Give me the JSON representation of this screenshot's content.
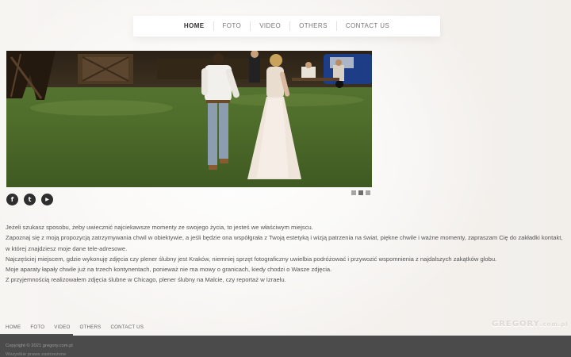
{
  "nav": {
    "items": [
      {
        "label": "HOME",
        "active": true
      },
      {
        "label": "FOTO"
      },
      {
        "label": "VIDEO"
      },
      {
        "label": "OTHERS"
      },
      {
        "label": "CONTACT US"
      }
    ]
  },
  "slider": {
    "slide_count": 3,
    "active_index": 1
  },
  "social": [
    {
      "icon": "facebook-icon",
      "glyph": "f"
    },
    {
      "icon": "twitter-icon",
      "glyph": "t"
    },
    {
      "icon": "youtube-icon",
      "glyph": "▶"
    }
  ],
  "content": {
    "paragraphs": [
      "Jeżeli szukasz sposobu, żeby uwiecznić najciekawsze momenty ze swojego życia, to jesteś we właściwym miejscu.",
      "Zapoznaj się z moją propozycją zatrzymywania chwil w obiektywie, a jeśli będzie ona współgrała z Twoją estetyką i wizją patrzenia na świat, piękne chwile i ważne momenty, zapraszam Cię do zakładki kontakt, w której znajdziesz moje dane tele-adresowe.",
      "Najczęściej miejscem, gdzie wykonuję zdjęcia czy plener ślubny jest Kraków,  niemniej sprzęt fotograficzny uwielbia podróżować i przywozić wspomnienia z najdalszych zakątków globu.",
      "Moje aparaty łapały chwile już na trzech kontynentach, ponieważ nie ma mowy o granicach, kiedy chodzi o Wasze zdjęcia.",
      "Z przyjemnością realizowałem zdjęcia ślubne w Chicago, plener ślubny na Malcie, czy reportaż w Izraelu."
    ]
  },
  "footer": {
    "nav": [
      "HOME",
      "FOTO",
      "VIDEO",
      "OTHERS",
      "CONTACT US"
    ],
    "logo_main": "GREGORY",
    "logo_domain": ".com.pl",
    "copyright": "Copyright © 2021 gregory.com.pl",
    "rights": "Wszystkie prawa zastrzeżone"
  },
  "colors": {
    "page_bg": "#f3f1ee",
    "footer_bar": "#4b4b4b",
    "social_bg": "#2e2e2e"
  }
}
